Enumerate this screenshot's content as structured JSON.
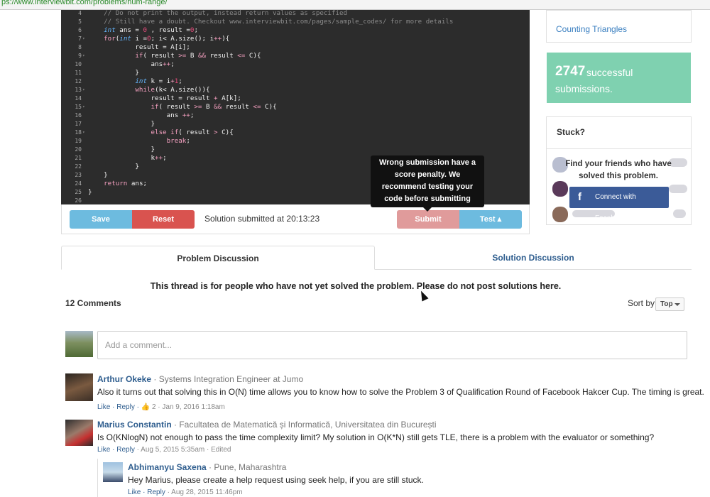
{
  "browser": {
    "url": "ps://www.interviewbit.com/problems/num-range/"
  },
  "editor": {
    "lines": [
      {
        "n": "4",
        "fold": "",
        "html": "<span class=\"c\">    // Do not print the output, instead return values as specified</span>"
      },
      {
        "n": "5",
        "fold": "",
        "html": "<span class=\"c\">    // Still have a doubt. Checkout www.interviewbit.com/pages/sample_codes/ for more details</span>"
      },
      {
        "n": "6",
        "fold": "",
        "html": "    <span class=\"t\">int</span> ans = <span class=\"n\">0</span> , result =<span class=\"n\">0</span>;"
      },
      {
        "n": "7",
        "fold": "▾",
        "html": "    <span class=\"o\">for</span>(<span class=\"t\">int</span> i =<span class=\"n\">0</span>; i&lt; A.size(); i<span class=\"o\">++</span>){"
      },
      {
        "n": "8",
        "fold": "",
        "html": "            result = A[i];"
      },
      {
        "n": "9",
        "fold": "▾",
        "html": "            <span class=\"o\">if</span>( result <span class=\"o\">&gt;=</span> B <span class=\"o\">&amp;&amp;</span> result <span class=\"o\">&lt;=</span> C){"
      },
      {
        "n": "10",
        "fold": "",
        "html": "                ans<span class=\"o\">++</span>;"
      },
      {
        "n": "11",
        "fold": "",
        "html": "            }"
      },
      {
        "n": "12",
        "fold": "",
        "html": "            <span class=\"t\">int</span> k = i<span class=\"o\">+</span><span class=\"n\">1</span>;"
      },
      {
        "n": "13",
        "fold": "▾",
        "html": "            <span class=\"o\">while</span>(k&lt; A.size()){"
      },
      {
        "n": "14",
        "fold": "",
        "html": "                result = result <span class=\"o\">+</span> A[k];"
      },
      {
        "n": "15",
        "fold": "▾",
        "html": "                <span class=\"o\">if</span>( result <span class=\"o\">&gt;=</span> B <span class=\"o\">&amp;&amp;</span> result <span class=\"o\">&lt;=</span> C){"
      },
      {
        "n": "16",
        "fold": "",
        "html": "                    ans <span class=\"o\">++</span>;"
      },
      {
        "n": "17",
        "fold": "",
        "html": "                }"
      },
      {
        "n": "18",
        "fold": "▾",
        "html": "                <span class=\"o\">else if</span>( result <span class=\"o\">&gt;</span> C){"
      },
      {
        "n": "19",
        "fold": "",
        "html": "                    <span class=\"o\">break</span>;"
      },
      {
        "n": "20",
        "fold": "",
        "html": "                }"
      },
      {
        "n": "21",
        "fold": "",
        "html": "                k<span class=\"o\">++</span>;"
      },
      {
        "n": "22",
        "fold": "",
        "html": "            }"
      },
      {
        "n": "23",
        "fold": "",
        "html": "    }"
      },
      {
        "n": "24",
        "fold": "",
        "html": "    <span class=\"o\">return</span> ans;"
      },
      {
        "n": "25",
        "fold": "",
        "html": "}"
      },
      {
        "n": "26",
        "fold": "",
        "html": ""
      }
    ]
  },
  "toolbar": {
    "save_label": "Save",
    "reset_label": "Reset",
    "submitted_text": "Solution submitted at 20:13:23",
    "submit_label": "Submit",
    "test_label": "Test ▴",
    "tooltip_lines": [
      "Wrong submission have a",
      "score penalty. We",
      "recommend testing your",
      "code before submitting"
    ]
  },
  "sidebar": {
    "related_link": "Counting Triangles",
    "success_count": "2747",
    "success_text_1": "successful",
    "success_text_2": "submissions.",
    "stuck_title": "Stuck?",
    "stuck_lines": [
      "Find your friends who have",
      "solved this problem."
    ],
    "facebook_label": "Connect with Facebook",
    "facebook_icon": "f"
  },
  "discussion": {
    "tabs": [
      "Problem Discussion",
      "Solution Discussion"
    ],
    "thread_note": "This thread is for people who have not yet solved the problem. Please do not post solutions here.",
    "comments_count": "12 Comments",
    "sort_label": "Sort by",
    "sort_value": "Top",
    "add_comment_placeholder": "Add a comment...",
    "comments": [
      {
        "author": "Arthur Okeke",
        "meta": " · Systems Integration Engineer at Jumo",
        "text": "Also it turns out that solving this in O(N) time allows you to know how to solve the Problem 3 of Qualification Round of Facebook Hakcer Cup. The timing is great.",
        "like": "Like",
        "reply": "Reply",
        "likes_icon": "thumbs-up-icon",
        "likes": "2",
        "date": " · Jan 9, 2016 1:18am"
      },
      {
        "author": "Marius Constantin",
        "meta": " · Facultatea de Matematică și Informatică, Universitatea din București",
        "text": "Is O(KNlogN) not enough to pass the time complexity limit? My solution in O(K*N) still gets TLE, there is a problem with the evaluator or something?",
        "like": "Like",
        "reply": "Reply",
        "date": " · Aug 5, 2015 5:35am · Edited"
      },
      {
        "author": "Abhimanyu Saxena",
        "meta": " · Pune, Maharashtra",
        "text": "Hey Marius, please create a help request using seek help, if you are still stuck.",
        "like": "Like",
        "reply": "Reply",
        "date": " · Aug 28, 2015 11:46pm"
      }
    ]
  },
  "colors": {
    "editor_bg": "#2c2c2c",
    "save": "#6dbbdf",
    "reset": "#d9534f",
    "submit": "#e09b9b",
    "success": "#7fd1b0",
    "facebook": "#3b5b98",
    "link": "#2e5d8e"
  }
}
